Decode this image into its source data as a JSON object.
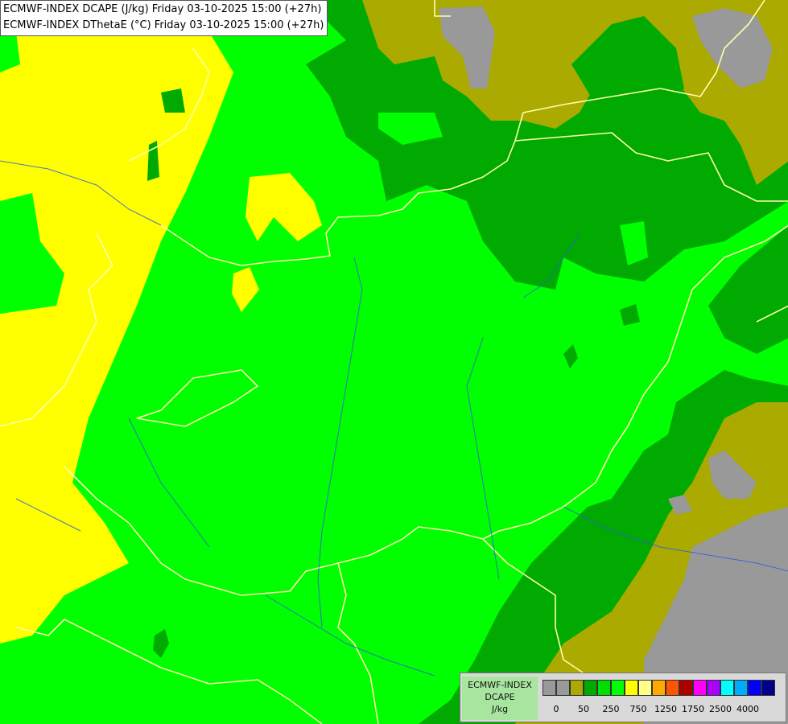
{
  "title": {
    "line1": "ECMWF-INDEX DCAPE (J/kg) Friday 03-10-2025 15:00 (+27h)",
    "line2": "ECMWF-INDEX DThetaE (°C) Friday 03-10-2025 15:00 (+27h)"
  },
  "legend": {
    "line1": "ECMWF-INDEX",
    "line2": "DCAPE",
    "line3": "J/kg",
    "swatches": [
      "#999999",
      "#999999",
      "#aaaa00",
      "#00aa00",
      "#00dd00",
      "#00ff00",
      "#ffff00",
      "#ffff88",
      "#ffaa00",
      "#ff5500",
      "#aa0000",
      "#ff00ff",
      "#aa00ff",
      "#00ffff",
      "#00aaff",
      "#0000ff",
      "#000088"
    ],
    "ticks": [
      "0",
      "50",
      "250",
      "750",
      "1250",
      "1750",
      "2500",
      "4000"
    ]
  },
  "colors": {
    "bright_green": "#00ff00",
    "mid_green": "#00aa00",
    "yellow": "#ffff00",
    "olive": "#aaaa00",
    "gray": "#999999",
    "border": "#ffffaa",
    "river": "#2e5fd6"
  }
}
